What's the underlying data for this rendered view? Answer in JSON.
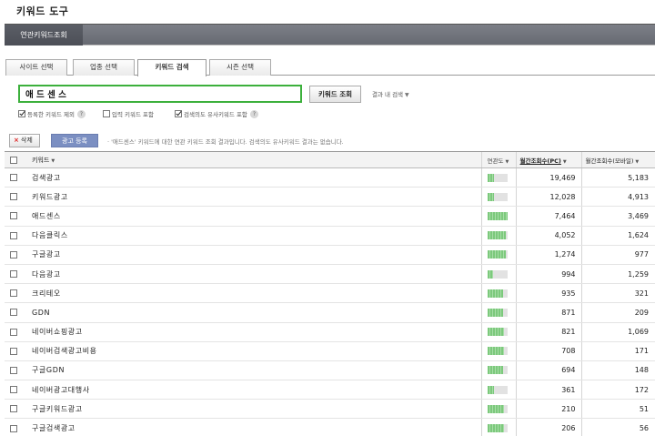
{
  "header": {
    "title": "키워드 도구"
  },
  "topnav": {
    "active_tab": "연관키워드조회"
  },
  "tabs": [
    {
      "label": "사이트 선택",
      "active": false
    },
    {
      "label": "업종 선택",
      "active": false
    },
    {
      "label": "키워드 검색",
      "active": true
    },
    {
      "label": "시즌 선택",
      "active": false
    }
  ],
  "search": {
    "value": "애 드 센 스",
    "button_label": "키워드 조회",
    "in_result_label": "결과 내 검색"
  },
  "options": [
    {
      "label": "등록한 키워드 제외",
      "checked": true
    },
    {
      "label": "입력 키워드 포함",
      "checked": false
    },
    {
      "label": "검색의도 유사키워드 포함",
      "checked": true
    }
  ],
  "help_glyph": "?",
  "toolbar": {
    "delete_label": "삭제",
    "delete_glyph": "×",
    "ad_register_label": "광고 등록",
    "notice": "· '애드센스' 키워드에 대한 연관 키워드 조회 결과입니다. 검색의도 유사키워드 결과는 없습니다."
  },
  "table": {
    "columns": {
      "keyword": "키워드",
      "relevance": "연관도",
      "monthly_pc": "월간조회수(PC)",
      "monthly_mobile": "월간조회수(모바일)"
    },
    "sort_glyph": "▼",
    "rows": [
      {
        "keyword": "검색광고",
        "relevance": 0.35,
        "pc": "19,469",
        "mobile": "5,183"
      },
      {
        "keyword": "키워드광고",
        "relevance": 0.35,
        "pc": "12,028",
        "mobile": "4,913"
      },
      {
        "keyword": "애드센스",
        "relevance": 1.0,
        "pc": "7,464",
        "mobile": "3,469"
      },
      {
        "keyword": "다음클릭스",
        "relevance": 0.95,
        "pc": "4,052",
        "mobile": "1,624"
      },
      {
        "keyword": "구글광고",
        "relevance": 0.95,
        "pc": "1,274",
        "mobile": "977"
      },
      {
        "keyword": "다음광고",
        "relevance": 0.3,
        "pc": "994",
        "mobile": "1,259"
      },
      {
        "keyword": "크리테오",
        "relevance": 0.8,
        "pc": "935",
        "mobile": "321"
      },
      {
        "keyword": "GDN",
        "relevance": 0.8,
        "pc": "871",
        "mobile": "209"
      },
      {
        "keyword": "네이버쇼핑광고",
        "relevance": 0.85,
        "pc": "821",
        "mobile": "1,069"
      },
      {
        "keyword": "네이버검색광고비용",
        "relevance": 0.85,
        "pc": "708",
        "mobile": "171"
      },
      {
        "keyword": "구글GDN",
        "relevance": 0.8,
        "pc": "694",
        "mobile": "148"
      },
      {
        "keyword": "네이버광고대행사",
        "relevance": 0.35,
        "pc": "361",
        "mobile": "172"
      },
      {
        "keyword": "구글키워드광고",
        "relevance": 0.85,
        "pc": "210",
        "mobile": "51"
      },
      {
        "keyword": "구글검색광고",
        "relevance": 0.85,
        "pc": "206",
        "mobile": "56"
      }
    ]
  },
  "colors": {
    "topbar": "#6e7179",
    "search_border": "#3cb03c",
    "ad_button": "#7b8fc2",
    "relevance_fill": "#7cc97c"
  }
}
